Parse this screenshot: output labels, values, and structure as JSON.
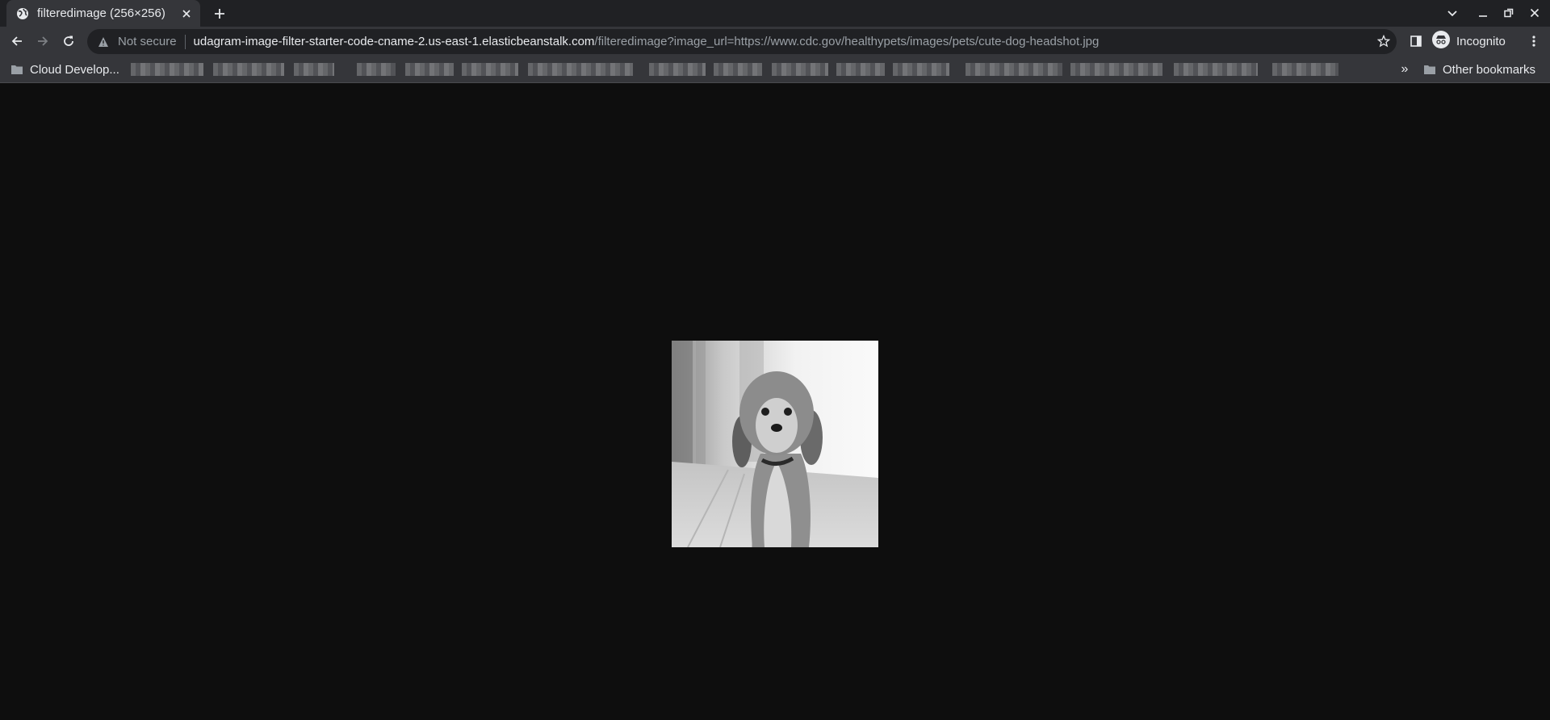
{
  "tab": {
    "title": "filteredimage (256×256)"
  },
  "omnibox": {
    "security_label": "Not secure",
    "host": "udagram-image-filter-starter-code-cname-2.us-east-1.elasticbeanstalk.com",
    "path": "/filteredimage?image_url=https://www.cdc.gov/healthypets/images/pets/cute-dog-headshot.jpg"
  },
  "profile": {
    "label": "Incognito"
  },
  "bookmarks": {
    "first_folder": "Cloud Develop...",
    "other": "Other bookmarks",
    "overflow": "»"
  },
  "content": {
    "image_alt": "cute-dog-headshot.jpg (grayscale)"
  },
  "colors": {
    "tabstrip": "#202124",
    "toolbar": "#35363a",
    "page_bg": "#0e0e0e",
    "text": "#e8eaed",
    "muted": "#9aa0a6"
  }
}
